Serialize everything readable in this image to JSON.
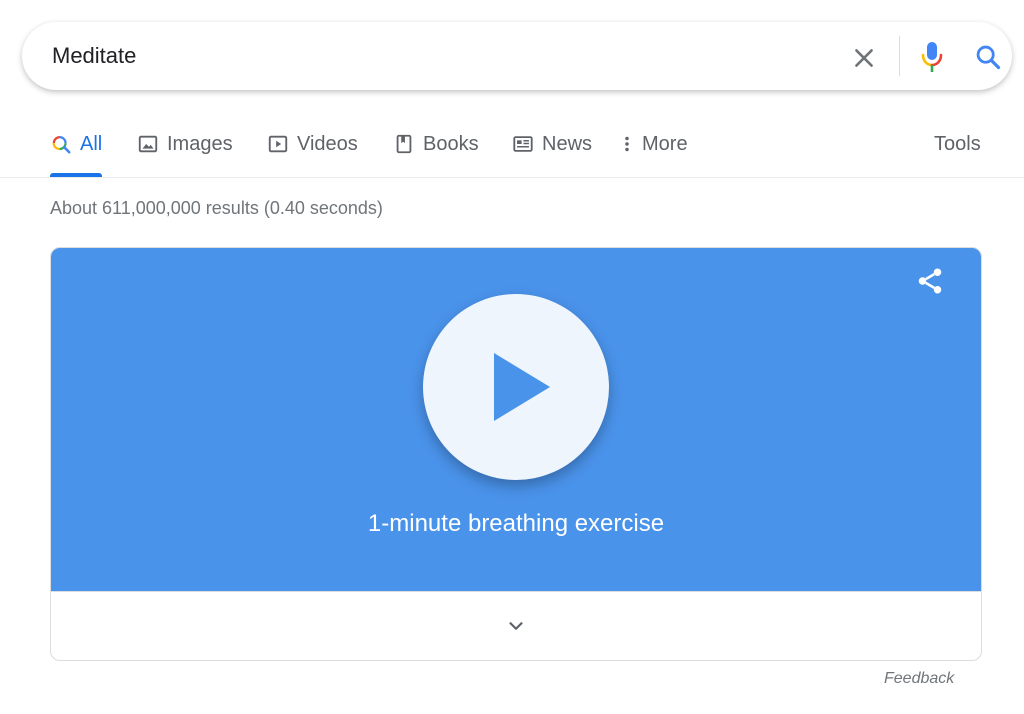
{
  "search": {
    "query": "Meditate"
  },
  "icons": {
    "clear": "close-icon",
    "mic": "microphone-icon",
    "search": "search-icon",
    "share": "share-icon",
    "play": "play-icon",
    "expand": "chevron-down-icon"
  },
  "tabs": [
    {
      "label": "All",
      "icon": "search-icon",
      "active": true
    },
    {
      "label": "Images",
      "icon": "image-icon",
      "active": false
    },
    {
      "label": "Videos",
      "icon": "video-icon",
      "active": false
    },
    {
      "label": "Books",
      "icon": "book-icon",
      "active": false
    },
    {
      "label": "News",
      "icon": "news-icon",
      "active": false
    },
    {
      "label": "More",
      "icon": "more-vertical-icon",
      "active": false
    }
  ],
  "tools_label": "Tools",
  "result_stats": "About 611,000,000 results (0.40 seconds)",
  "card": {
    "exercise_label": "1-minute breathing exercise",
    "hero_color": "#4a93eb"
  },
  "feedback_label": "Feedback",
  "colors": {
    "accent": "#1a73e8",
    "text_secondary": "#5f6368",
    "google_blue": "#4285f4",
    "google_red": "#ea4335",
    "google_yellow": "#fbbc04",
    "google_green": "#34a853"
  }
}
